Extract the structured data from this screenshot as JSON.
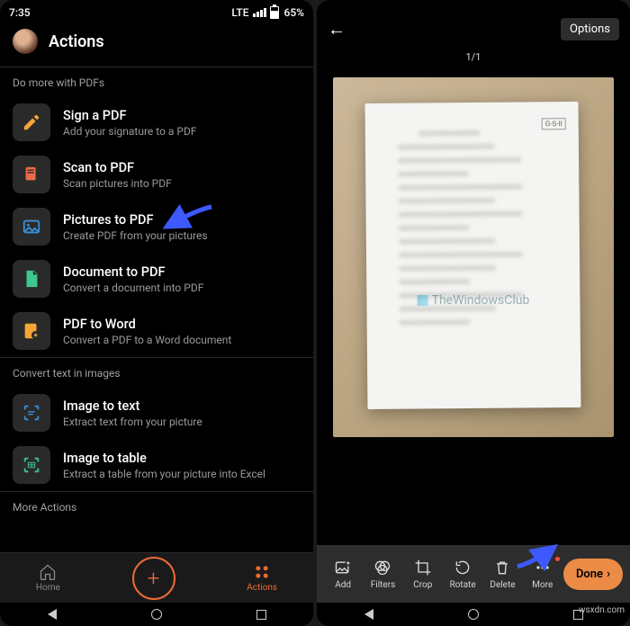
{
  "left": {
    "status": {
      "time": "7:35",
      "net": "LTE",
      "battery": "65%"
    },
    "title": "Actions",
    "sections": [
      {
        "label": "Do more with PDFs",
        "items": [
          {
            "title": "Sign a PDF",
            "sub": "Add your signature to a PDF",
            "icon": "pen",
            "color": "#f5a537"
          },
          {
            "title": "Scan to PDF",
            "sub": "Scan pictures into PDF",
            "icon": "scan",
            "color": "#ec6b4b"
          },
          {
            "title": "Pictures to PDF",
            "sub": "Create PDF from your pictures",
            "icon": "image",
            "color": "#3a8fd9"
          },
          {
            "title": "Document to PDF",
            "sub": "Convert a document into PDF",
            "icon": "doc",
            "color": "#3fc792"
          },
          {
            "title": "PDF to Word",
            "sub": "Convert a PDF to a Word document",
            "icon": "pdfword",
            "color": "#f5a537"
          }
        ]
      },
      {
        "label": "Convert text in images",
        "items": [
          {
            "title": "Image to text",
            "sub": "Extract text from your picture",
            "icon": "imgtxt",
            "color": "#3a8fd9"
          },
          {
            "title": "Image to table",
            "sub": "Extract a table from your picture into Excel",
            "icon": "imgtbl",
            "color": "#3fc792"
          }
        ]
      },
      {
        "label": "More Actions",
        "items": []
      }
    ],
    "tabs": {
      "home": "Home",
      "actions": "Actions"
    }
  },
  "right": {
    "options": "Options",
    "counter": "1/1",
    "corner_tag": "G-S-II",
    "watermark": "TheWindowsClub",
    "tools": {
      "add": "Add",
      "filters": "Filters",
      "crop": "Crop",
      "rotate": "Rotate",
      "delete": "Delete",
      "more": "More",
      "done": "Done"
    }
  },
  "site_watermark": "wsxdn.com"
}
